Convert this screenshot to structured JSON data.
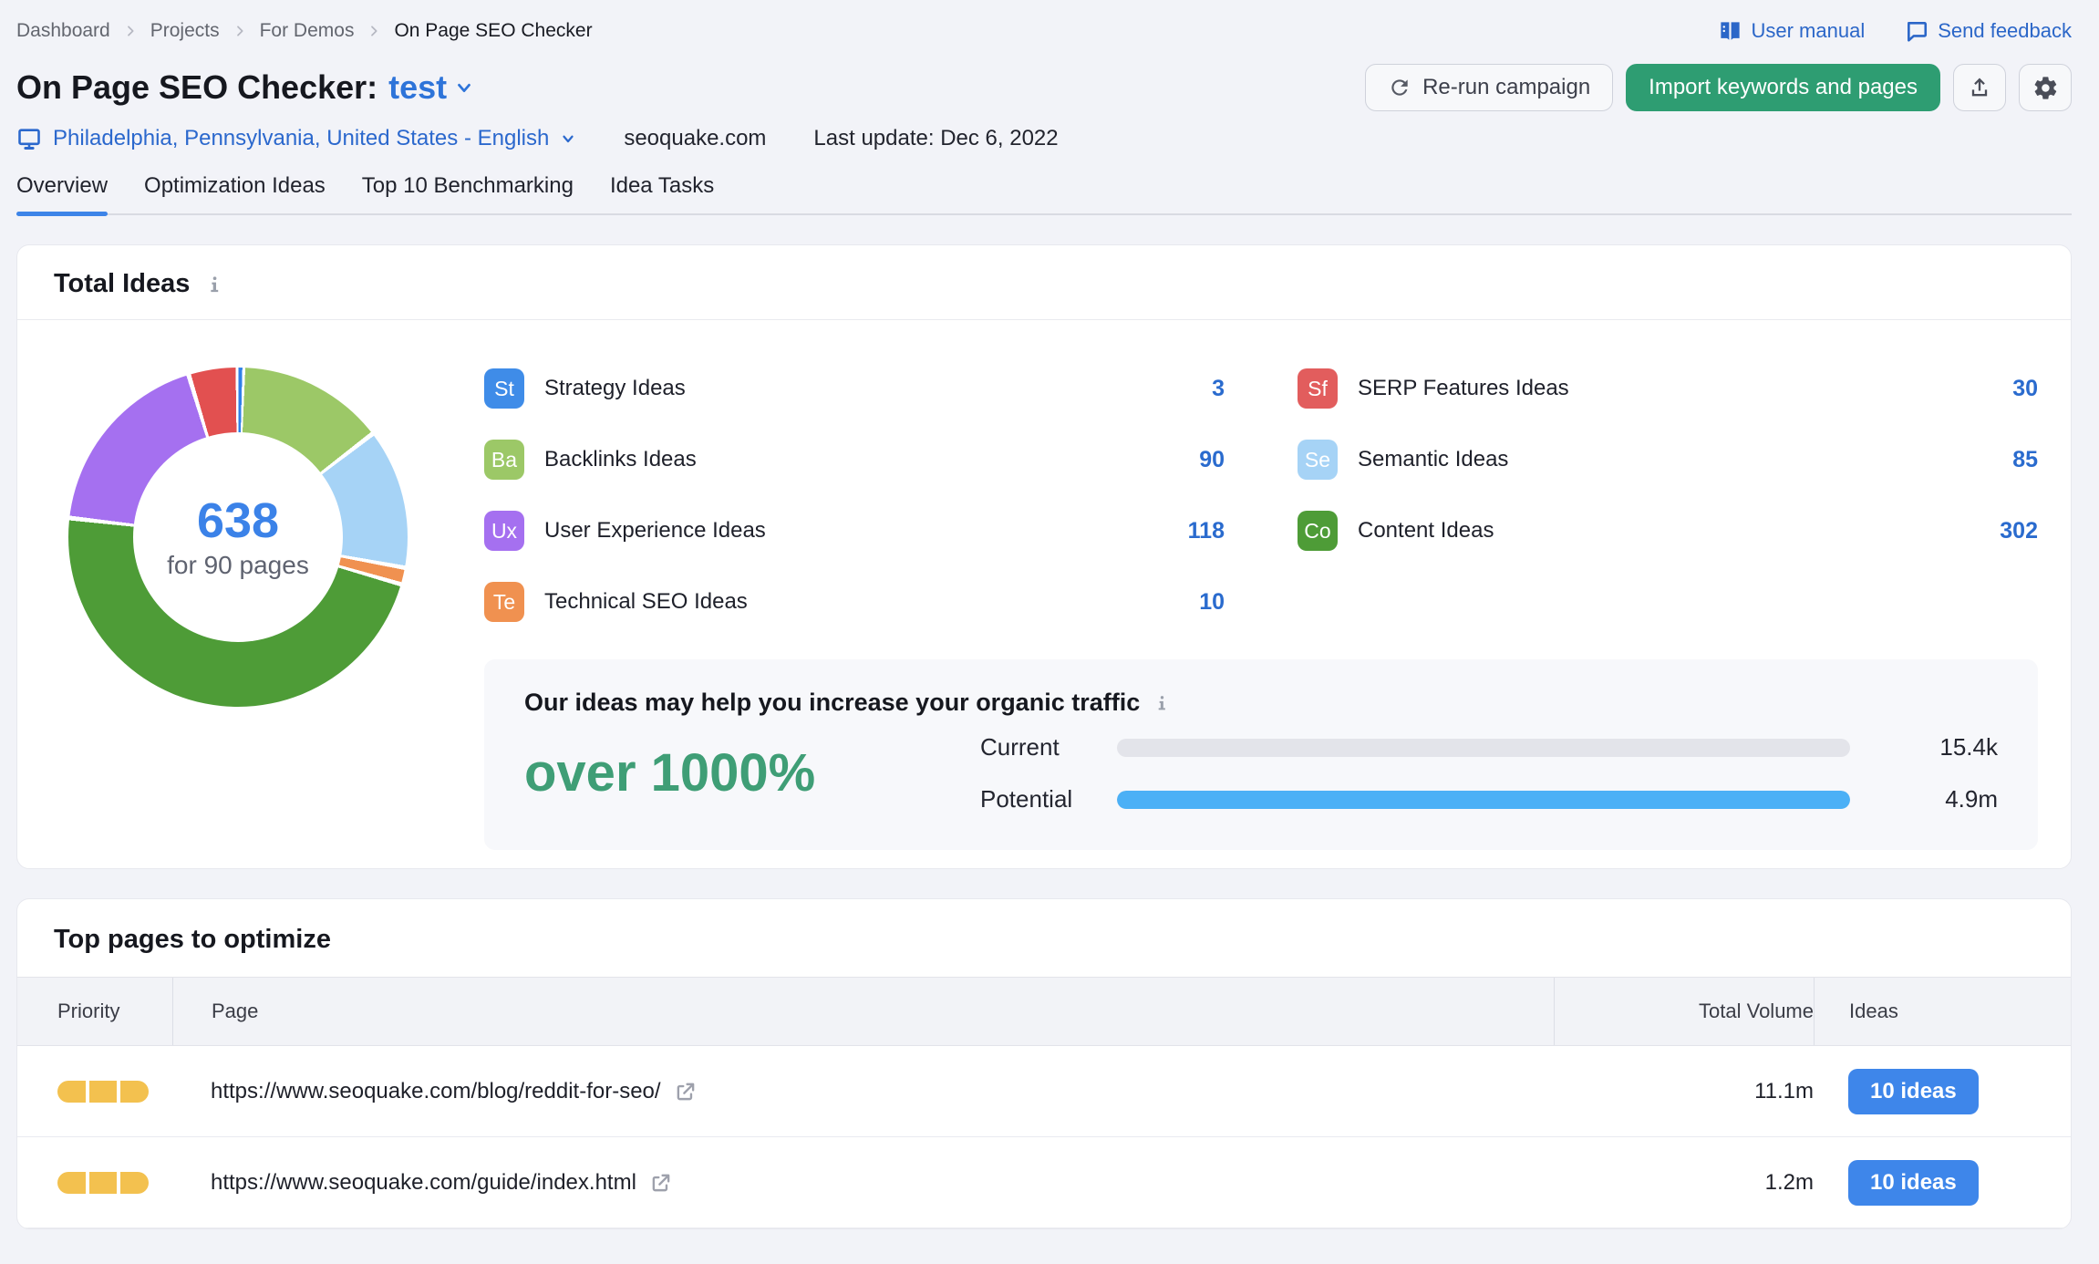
{
  "breadcrumb": {
    "items": [
      "Dashboard",
      "Projects",
      "For Demos"
    ],
    "current": "On Page SEO Checker"
  },
  "topbar": {
    "user_manual": "User manual",
    "send_feedback": "Send feedback"
  },
  "header": {
    "title": "On Page SEO Checker:",
    "project": "test",
    "rerun_label": "Re-run campaign",
    "import_label": "Import keywords and pages"
  },
  "meta": {
    "location": "Philadelphia, Pennsylvania, United States - English",
    "domain": "seoquake.com",
    "last_update": "Last update: Dec 6, 2022"
  },
  "tabs": [
    {
      "label": "Overview",
      "active": true
    },
    {
      "label": "Optimization Ideas",
      "active": false
    },
    {
      "label": "Top 10 Benchmarking",
      "active": false
    },
    {
      "label": "Idea Tasks",
      "active": false
    }
  ],
  "total_ideas": {
    "title": "Total Ideas",
    "center_value": "638",
    "center_caption": "for 90 pages",
    "left": [
      {
        "abbr": "St",
        "label": "Strategy Ideas",
        "count": "3",
        "color": "#3f8ce8"
      },
      {
        "abbr": "Ba",
        "label": "Backlinks Ideas",
        "count": "90",
        "color": "#9cc867"
      },
      {
        "abbr": "Ux",
        "label": "User Experience Ideas",
        "count": "118",
        "color": "#a570f0"
      },
      {
        "abbr": "Te",
        "label": "Technical SEO Ideas",
        "count": "10",
        "color": "#f09150"
      }
    ],
    "right": [
      {
        "abbr": "Sf",
        "label": "SERP Features Ideas",
        "count": "30",
        "color": "#e25d5d"
      },
      {
        "abbr": "Se",
        "label": "Semantic Ideas",
        "count": "85",
        "color": "#a6d3f6"
      },
      {
        "abbr": "Co",
        "label": "Content Ideas",
        "count": "302",
        "color": "#4e9c37"
      }
    ]
  },
  "traffic": {
    "title": "Our ideas may help you increase your organic traffic",
    "highlight": "over 1000%",
    "rows": [
      {
        "label": "Current",
        "value": "15.4k",
        "fill_percent": 0
      },
      {
        "label": "Potential",
        "value": "4.9m",
        "fill_percent": 100
      }
    ]
  },
  "top_pages": {
    "title": "Top pages to optimize",
    "columns": [
      "Priority",
      "Page",
      "Total Volume",
      "Ideas"
    ],
    "rows": [
      {
        "priority_segments": 3,
        "url": "https://www.seoquake.com/blog/reddit-for-seo/",
        "total_volume": "11.1m",
        "ideas_label": "10 ideas"
      },
      {
        "priority_segments": 3,
        "url": "https://www.seoquake.com/guide/index.html",
        "total_volume": "1.2m",
        "ideas_label": "10 ideas"
      }
    ]
  },
  "chart_data": [
    {
      "type": "pie",
      "title": "Total Ideas",
      "center_label": "638",
      "center_caption": "for 90 pages",
      "total": 638,
      "legend_position": "right",
      "series": [
        {
          "name": "Strategy Ideas",
          "value": 3,
          "color": "#2f80e8"
        },
        {
          "name": "Backlinks Ideas",
          "value": 90,
          "color": "#9cc867"
        },
        {
          "name": "Semantic Ideas",
          "value": 85,
          "color": "#a6d3f6"
        },
        {
          "name": "Technical SEO Ideas",
          "value": 10,
          "color": "#f09150"
        },
        {
          "name": "Content Ideas",
          "value": 302,
          "color": "#4e9c37"
        },
        {
          "name": "User Experience Ideas",
          "value": 118,
          "color": "#a570f0"
        },
        {
          "name": "SERP Features Ideas",
          "value": 30,
          "color": "#e25050"
        }
      ]
    },
    {
      "type": "bar",
      "orientation": "horizontal",
      "title": "Our ideas may help you increase your organic traffic",
      "subtitle": "over 1000%",
      "categories": [
        "Current",
        "Potential"
      ],
      "values": [
        15400,
        4900000
      ],
      "value_labels": [
        "15.4k",
        "4.9m"
      ],
      "colors": [
        "#e3e4ea",
        "#4bb0f6"
      ]
    }
  ],
  "colors": {
    "accent_blue": "#3d84e8",
    "link_blue": "#2b68cd",
    "count_blue": "#2a6bce",
    "green_button": "#2e9d72",
    "highlight_green": "#3f9e76",
    "priority_yellow": "#f3c14f",
    "potential_bar_blue": "#4bb0f6",
    "current_bar_track": "#e3e4ea"
  }
}
